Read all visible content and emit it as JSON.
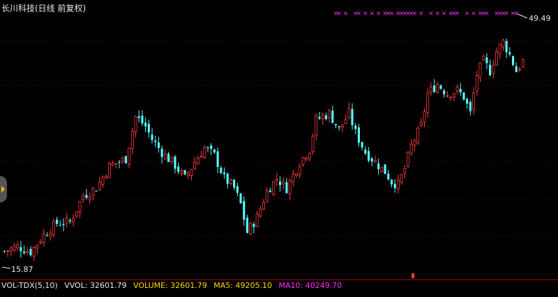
{
  "title": "长川科技(日线 前复权)",
  "colors": {
    "up": "#ff3c3c",
    "down": "#54ffff",
    "marker": "#ff30ff",
    "grid": "#7a0000"
  },
  "indicator": {
    "name": "VOL-TDX(5,10)",
    "vvol": "VVOL: 32601.79",
    "volume": "VOLUME: 32601.79",
    "ma5": "MA5: 49205.10",
    "ma10": "MA10: 40249.70",
    "name_color": "#e8e8e8",
    "vvol_color": "#e8e8e8",
    "volume_color": "#ffd700",
    "ma5_color": "#ffd700",
    "ma10_color": "#ff30ff"
  },
  "chart_data": {
    "type": "candlestick",
    "title": "长川科技(日线 前复权)",
    "ylim": [
      13,
      53
    ],
    "max_label": "49.49",
    "min_label": "15.87",
    "series_up_color": "#ff3c3c",
    "series_down_color": "#54ffff",
    "keypoints": [
      [
        0,
        16.3
      ],
      [
        4,
        17.0
      ],
      [
        8,
        16.2
      ],
      [
        12,
        18.8
      ],
      [
        16,
        20.6
      ],
      [
        20,
        20.8
      ],
      [
        24,
        24.8
      ],
      [
        28,
        26.0
      ],
      [
        32,
        29.4
      ],
      [
        37,
        30.5
      ],
      [
        40,
        37.0
      ],
      [
        43,
        35.5
      ],
      [
        45,
        33.5
      ],
      [
        48,
        31.5
      ],
      [
        52,
        29.5
      ],
      [
        55,
        27.5
      ],
      [
        58,
        30.0
      ],
      [
        61,
        32.2
      ],
      [
        64,
        31.0
      ],
      [
        67,
        27.5
      ],
      [
        70,
        26.0
      ],
      [
        72,
        23.5
      ],
      [
        74,
        19.2
      ],
      [
        77,
        21.5
      ],
      [
        80,
        25.5
      ],
      [
        83,
        27.5
      ],
      [
        86,
        26.0
      ],
      [
        90,
        30.0
      ],
      [
        93,
        32.0
      ],
      [
        95,
        36.5
      ],
      [
        99,
        37.5
      ],
      [
        102,
        35.0
      ],
      [
        105,
        37.5
      ],
      [
        107,
        34.5
      ],
      [
        110,
        31.5
      ],
      [
        113,
        30.0
      ],
      [
        116,
        28.5
      ],
      [
        118,
        27.0
      ],
      [
        120,
        26.5
      ],
      [
        122,
        29.0
      ],
      [
        124,
        32.5
      ],
      [
        127,
        35.5
      ],
      [
        129,
        40.5
      ],
      [
        132,
        42.0
      ],
      [
        135,
        40.5
      ],
      [
        138,
        41.0
      ],
      [
        140,
        40.0
      ],
      [
        142,
        37.5
      ],
      [
        144,
        43.5
      ],
      [
        146,
        45.5
      ],
      [
        148,
        44.0
      ],
      [
        150,
        47.0
      ],
      [
        152,
        48.5
      ],
      [
        154,
        46.5
      ],
      [
        156,
        44.0
      ],
      [
        158,
        45.5
      ]
    ],
    "candle_count": 159,
    "marker_symbol": "×",
    "marker_candles": [
      101,
      102,
      104,
      107,
      108,
      110,
      112,
      114,
      116,
      117,
      118,
      120,
      121,
      122,
      123,
      124,
      125,
      127,
      130,
      132,
      134,
      136,
      137,
      138,
      141,
      143,
      145,
      146,
      147,
      150,
      151,
      152,
      153,
      155,
      156
    ]
  }
}
